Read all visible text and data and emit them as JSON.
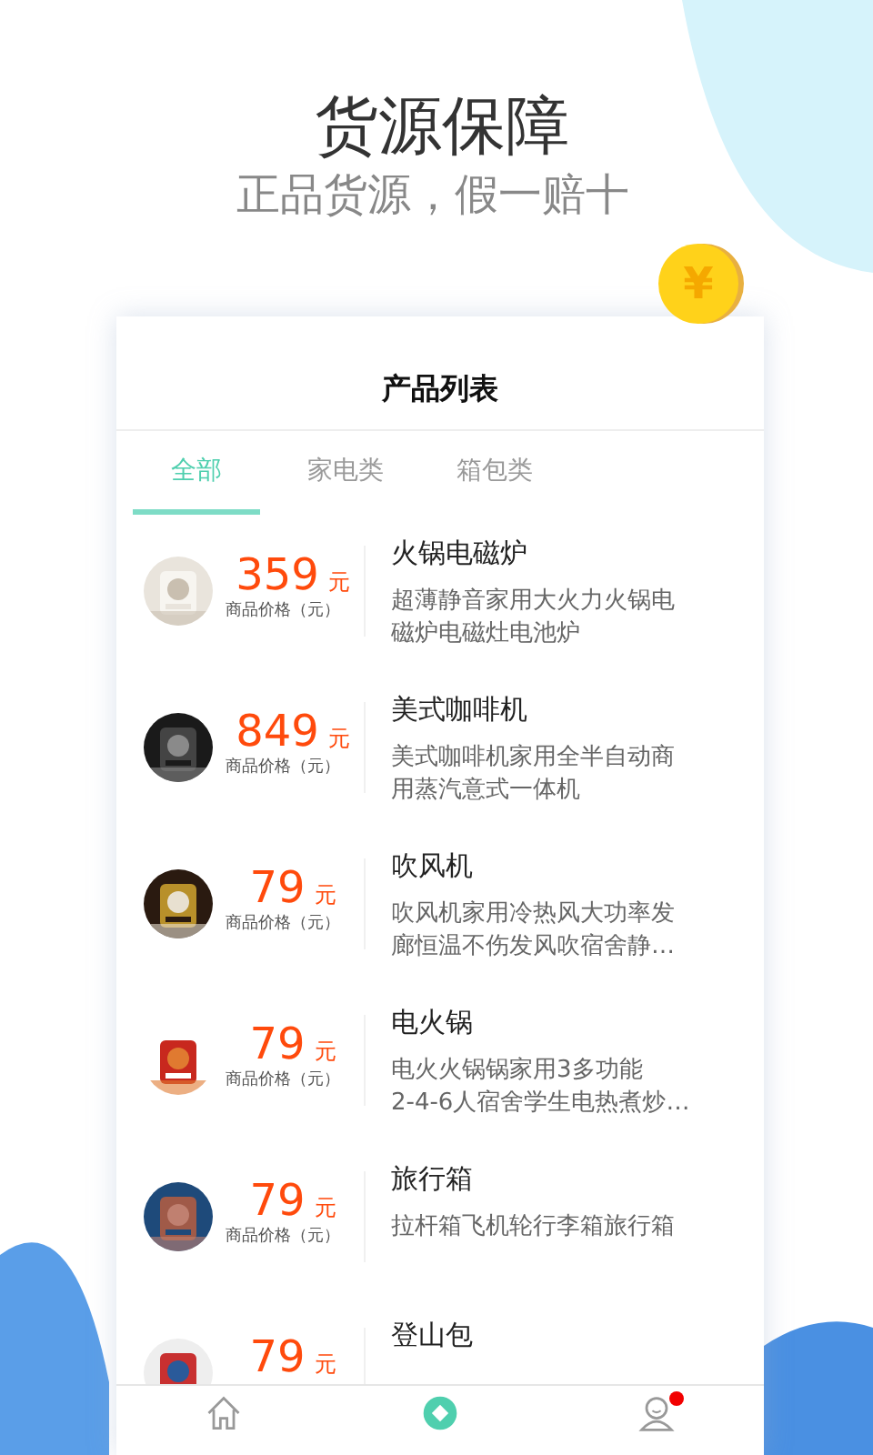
{
  "header": {
    "title": "货源保障",
    "subtitle": "正品货源，假一赔十"
  },
  "coin": {
    "symbol": "¥"
  },
  "card": {
    "title": "产品列表",
    "tabs": [
      {
        "label": "全部",
        "selected": true
      },
      {
        "label": "家电类",
        "selected": false
      },
      {
        "label": "箱包类",
        "selected": false
      }
    ],
    "items": [
      {
        "name": "火锅电磁炉",
        "price": "359",
        "unit": "元",
        "price_label": "商品价格（元）",
        "description": [
          "超薄静音家用大火力火锅电",
          "磁炉电磁灶电池炉"
        ],
        "kind": "picture"
      },
      {
        "name": "美式咖啡机",
        "price": "849",
        "unit": "元",
        "price_label": "商品价格（元）",
        "description": [
          "美式咖啡机家用全半自动商",
          "用蒸汽意式一体机"
        ],
        "kind": "picture"
      },
      {
        "name": "吹风机",
        "price": "79",
        "unit": "元",
        "price_label": "商品价格（元）",
        "description": [
          "吹风机家用冷热风大功率发",
          "廊恒温不伤发风吹宿舍静…"
        ],
        "kind": "picture"
      },
      {
        "name": "电火锅",
        "price": "79",
        "unit": "元",
        "price_label": "商品价格（元）",
        "description": [
          "电火火锅锅家用3多功能",
          "2-4-6人宿舍学生电热煮炒…"
        ],
        "kind": "picture"
      },
      {
        "name": "旅行箱",
        "price": "79",
        "unit": "元",
        "price_label": "商品价格（元）",
        "description": [
          "拉杆箱飞机轮行李箱旅行箱"
        ],
        "kind": "picture"
      },
      {
        "name": "登山包",
        "price": "79",
        "unit": "元",
        "kind": "picture"
      }
    ],
    "nav": [
      {
        "kind": "home",
        "selected": false,
        "badge": false
      },
      {
        "kind": "products",
        "selected": true,
        "badge": false
      },
      {
        "kind": "profile",
        "selected": false,
        "badge": true
      }
    ]
  }
}
